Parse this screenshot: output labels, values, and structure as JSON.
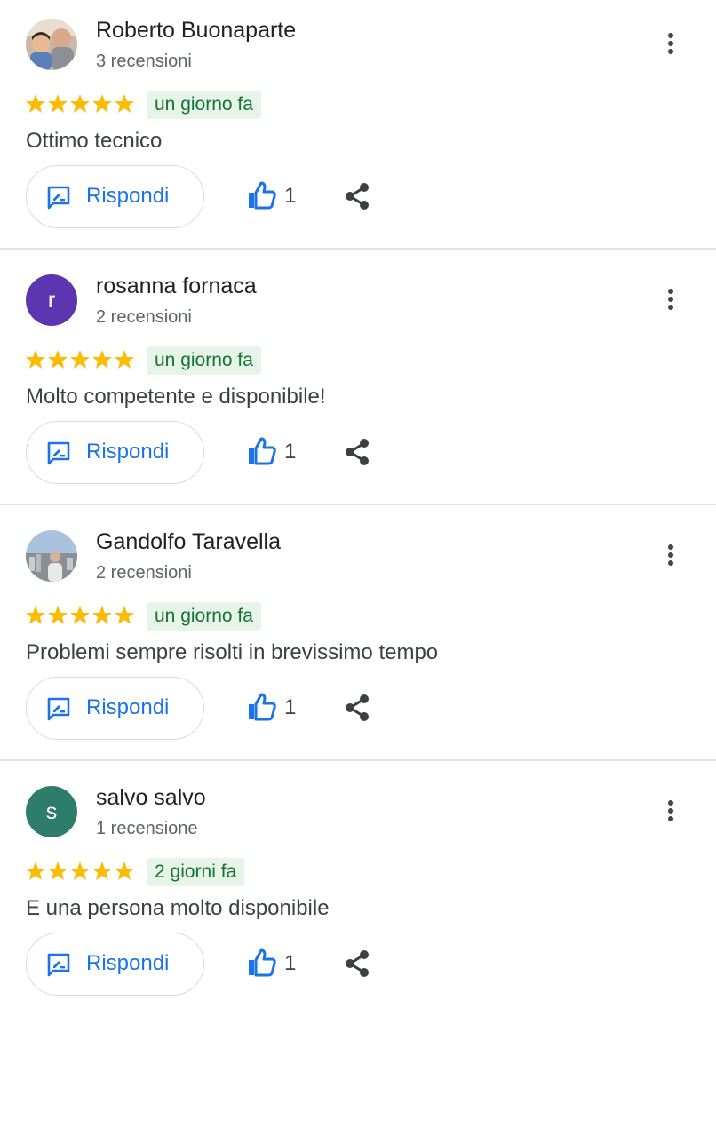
{
  "colors": {
    "star": "#fbbc04",
    "accent": "#1a73e8",
    "date_bg": "#e6f4ea",
    "date_text": "#137333",
    "avatar_r": "#5e35b1",
    "avatar_s": "#2e7d6b"
  },
  "reply_label": "Rispondi",
  "reviews": [
    {
      "name": "Roberto Buonaparte",
      "count": "3 recensioni",
      "stars": 5,
      "date": "un giorno fa",
      "text": "Ottimo tecnico",
      "likes": "1",
      "avatar": "photo-icon"
    },
    {
      "name": "rosanna fornaca",
      "count": "2 recensioni",
      "stars": 5,
      "date": "un giorno fa",
      "text": "Molto competente e disponibile!",
      "likes": "1",
      "avatar_letter": "r"
    },
    {
      "name": "Gandolfo Taravella",
      "count": "2 recensioni",
      "stars": 5,
      "date": "un giorno fa",
      "text": "Problemi sempre risolti in brevissimo tempo",
      "likes": "1",
      "avatar": "photo-icon"
    },
    {
      "name": "salvo salvo",
      "count": "1 recensione",
      "stars": 5,
      "date": "2 giorni fa",
      "text": "E una persona molto disponibile",
      "likes": "1",
      "avatar_letter": "s"
    }
  ]
}
